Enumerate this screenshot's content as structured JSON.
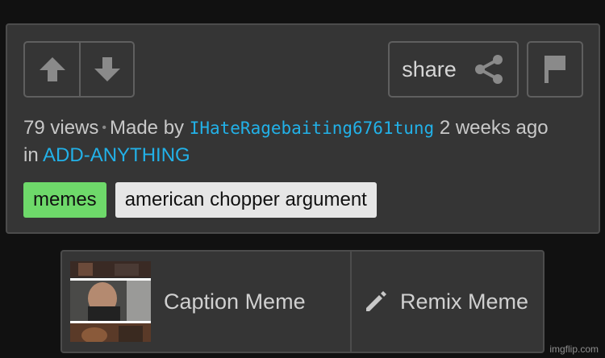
{
  "vote": {
    "upvote": "up-arrow-icon",
    "downvote": "down-arrow-icon"
  },
  "share": {
    "label": "share",
    "icon": "share-icon"
  },
  "flag": {
    "icon": "flag-icon"
  },
  "meta": {
    "views": "79 views",
    "made_by_prefix": "Made by",
    "username": "IHateRagebaiting6761tung",
    "time_ago": "2 weeks ago",
    "in_prefix": "in",
    "stream": "ADD-ANYTHING"
  },
  "tags": [
    {
      "label": "memes",
      "color": "#6ed96a"
    },
    {
      "label": "american chopper argument",
      "color": "#e6e6e6"
    }
  ],
  "actions": {
    "caption_label": "Caption Meme",
    "remix_label": "Remix Meme",
    "remix_icon": "pencil-icon"
  },
  "watermark": "imgflip.com",
  "colors": {
    "link": "#22b1e8",
    "panel": "#353535",
    "background": "#111111"
  }
}
